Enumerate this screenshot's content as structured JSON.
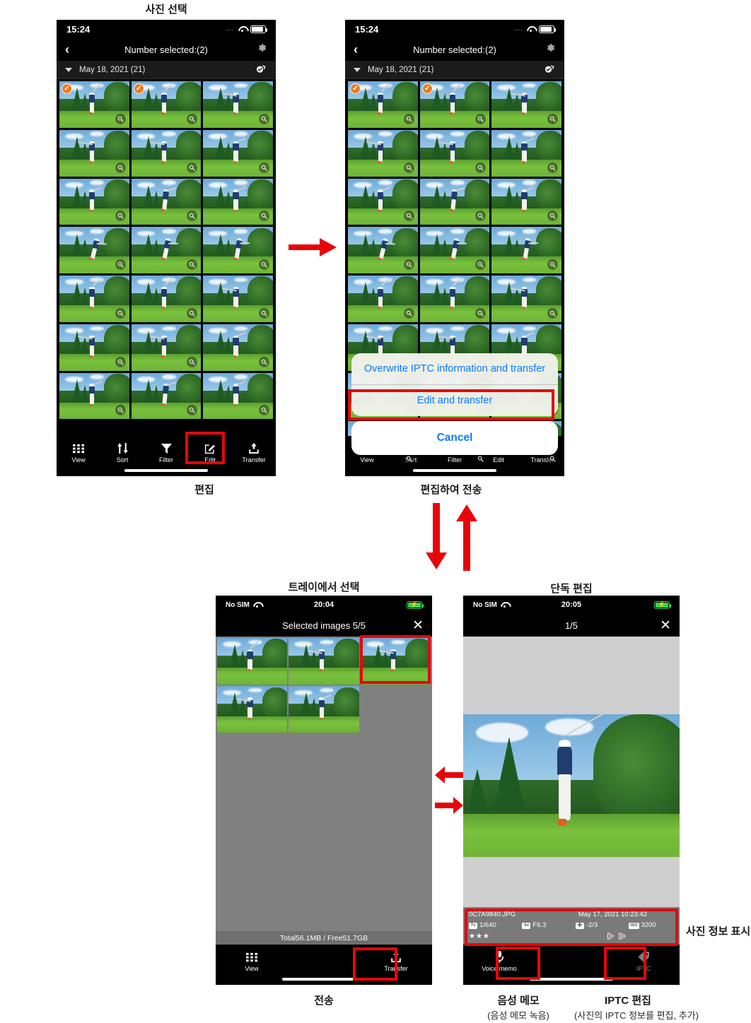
{
  "captions": {
    "select_photos": "사진 선택",
    "edit": "편집",
    "edit_and_transfer": "편집하여 전송",
    "select_from_tray": "트레이에서 선택",
    "single_edit": "단독 편집",
    "transfer": "전송",
    "photo_info_display": "사진 정보 표시",
    "voice_memo_title": "음성 메모",
    "voice_memo_sub": "(음성 메모 녹음)",
    "iptc_title": "IPTC 편집",
    "iptc_sub": "(사진의 IPTC 정보를 편집, 추가)"
  },
  "colors": {
    "highlight": "#e8050a",
    "selection": "#ef6c1a",
    "ios_blue": "#0a7cff",
    "check_orange": "#ef7a1c"
  },
  "phone1": {
    "status": {
      "time": "15:24",
      "signal_dots": "....",
      "wifi_icon": "wifi-icon",
      "battery_icon": "battery-icon"
    },
    "nav": {
      "back_icon": "chevron-left-icon",
      "title": "Number selected:(2)",
      "gear_icon": "gear-icon"
    },
    "datebar": {
      "chevron_icon": "triangle-down-icon",
      "label": "May 18, 2021 (21)",
      "select_all_icon": "select-all-icon"
    },
    "grid": {
      "rows": 7,
      "cols": 3,
      "checked_indices": [
        0,
        1
      ],
      "ring_index": 1,
      "loupe_icon": "magnifier-icon"
    },
    "tabs": [
      {
        "label": "View",
        "icon": "grid-icon"
      },
      {
        "label": "Sort",
        "icon": "sort-arrows-icon"
      },
      {
        "label": "Filter",
        "icon": "funnel-icon"
      },
      {
        "label": "Edit",
        "icon": "pencil-square-icon"
      },
      {
        "label": "Transfer",
        "icon": "upload-icon"
      }
    ],
    "highlight_tab": "Edit"
  },
  "phone2": {
    "status": {
      "time": "15:24",
      "signal_dots": "....",
      "wifi_icon": "wifi-icon",
      "battery_icon": "battery-icon"
    },
    "nav": {
      "back_icon": "chevron-left-icon",
      "title": "Number selected:(2)",
      "gear_icon": "gear-icon"
    },
    "datebar": {
      "chevron_icon": "triangle-down-icon",
      "label": "May 18, 2021 (21)",
      "select_all_icon": "select-all-icon"
    },
    "grid": {
      "rows": 8,
      "cols": 3,
      "checked_indices": [
        0,
        1
      ],
      "ring_index": 1,
      "loupe_icon": "magnifier-icon"
    },
    "tabs": [
      {
        "label": "View",
        "icon": "grid-icon"
      },
      {
        "label": "Sort",
        "icon": "sort-arrows-icon"
      },
      {
        "label": "Filter",
        "icon": "funnel-icon"
      },
      {
        "label": "Edit",
        "icon": "pencil-square-icon"
      },
      {
        "label": "Transfer",
        "icon": "upload-icon"
      }
    ],
    "action_sheet": {
      "options": [
        "Overwrite IPTC information and transfer",
        "Edit and transfer"
      ],
      "cancel": "Cancel",
      "highlight_option": "Edit and transfer"
    }
  },
  "phone3": {
    "status": {
      "carrier": "No SIM",
      "wifi_icon": "wifi-icon",
      "time": "20:04",
      "battery_icon": "battery-charging-icon"
    },
    "nav": {
      "title": "Selected images 5/5",
      "close_icon": "close-x-icon"
    },
    "tray": {
      "count": 5,
      "cells": 6,
      "highlight_index": 2
    },
    "total_label": "Total56.1MB / Free51.7GB",
    "tabs": [
      {
        "label": "View",
        "icon": "grid-icon"
      },
      {
        "label": "",
        "icon": ""
      },
      {
        "label": "Transfer",
        "icon": "upload-icon"
      }
    ],
    "highlight_tab": "Transfer"
  },
  "phone4": {
    "status": {
      "carrier": "No SIM",
      "wifi_icon": "wifi-icon",
      "time": "20:05",
      "battery_icon": "battery-charging-icon"
    },
    "nav": {
      "title": "1/5",
      "close_icon": "close-x-icon"
    },
    "info": {
      "filename": "0C7A9840.JPG",
      "datetime": "May 17, 2021 10:23:42",
      "exif": [
        {
          "tag": "Tv",
          "value": "1/640"
        },
        {
          "tag": "Av",
          "value": "F6.3"
        },
        {
          "tag": "➕",
          "value": "-2/3"
        },
        {
          "tag": "ISO",
          "value": "3200"
        }
      ],
      "rating": "★★★",
      "flags_icon": "transfer-flags-icon"
    },
    "tabs": [
      {
        "label": "Voice memo",
        "icon": "microphone-icon"
      },
      {
        "label": "",
        "icon": ""
      },
      {
        "label": "IPTC",
        "icon": "tag-icon"
      }
    ],
    "highlight_tabs": [
      "Voice memo",
      "IPTC"
    ]
  },
  "arrows": {
    "a1": "arrow-right",
    "a2_down": "arrow-down",
    "a2_up": "arrow-up",
    "a3_left": "arrow-left",
    "a3_right": "arrow-right"
  }
}
